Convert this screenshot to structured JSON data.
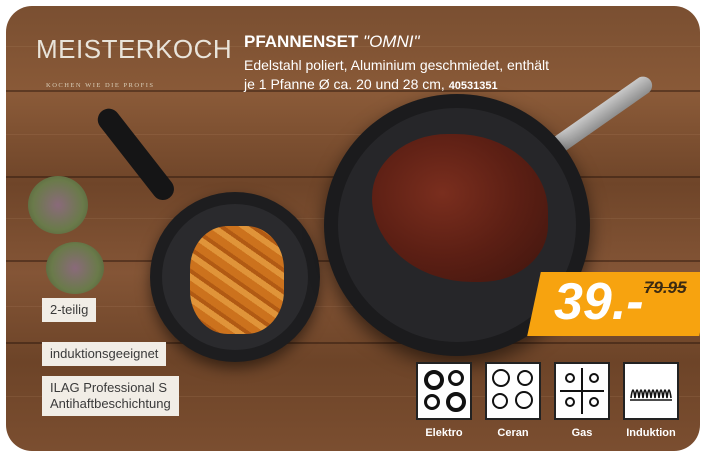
{
  "brand": {
    "logo_text": "MEISTERKOCH",
    "tagline": "KOCHEN WIE DIE PROFIS"
  },
  "product": {
    "title_bold": "PFANNENSET",
    "title_italic": "\"OMNI\"",
    "description_line1": "Edelstahl poliert, Aluminium geschmiedet, enthält",
    "description_line2": "je 1 Pfanne Ø ca. 20 und 28 cm,",
    "article_number": "40531351"
  },
  "features": [
    "2-teilig",
    "induktionsgeeignet",
    "ILAG Professional S",
    "Antihaftbeschichtung"
  ],
  "price": {
    "current": "39.-",
    "old": "79.95",
    "color": "#f7a30f"
  },
  "cooktops": [
    {
      "label": "Elektro",
      "icon": "electric-stove-icon"
    },
    {
      "label": "Ceran",
      "icon": "ceramic-stove-icon"
    },
    {
      "label": "Gas",
      "icon": "gas-stove-icon"
    },
    {
      "label": "Induktion",
      "icon": "induction-icon"
    }
  ]
}
